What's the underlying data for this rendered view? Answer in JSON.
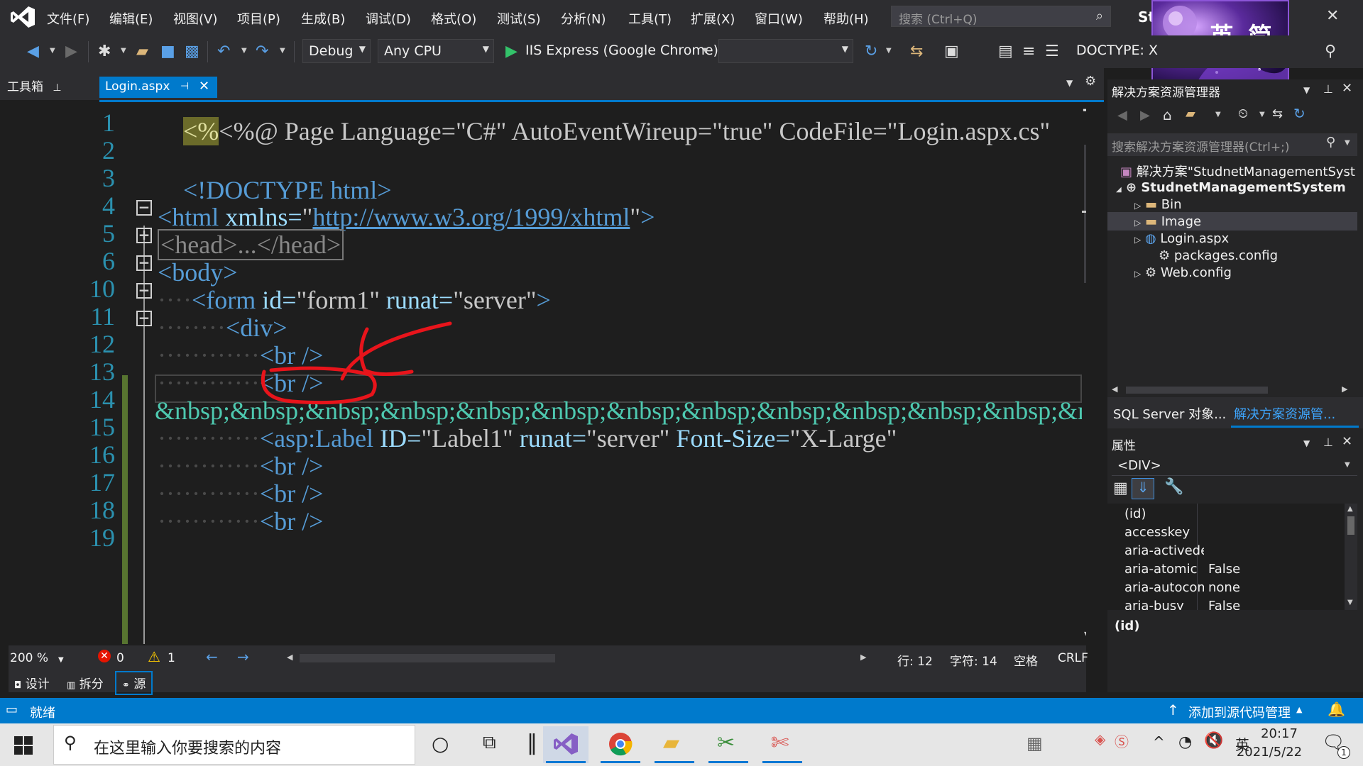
{
  "menu": [
    "文件(F)",
    "编辑(E)",
    "视图(V)",
    "项目(P)",
    "生成(B)",
    "调试(D)",
    "格式(O)",
    "测试(S)",
    "分析(N)",
    "工具(T)",
    "扩展(X)",
    "窗口(W)",
    "帮助(H)"
  ],
  "quick_search": {
    "placeholder": "搜索 (Ctrl+Q)"
  },
  "title_short": "St",
  "avatar_text": "英 简",
  "toolbar": {
    "config": "Debug",
    "platform": "Any CPU",
    "run_target": "IIS Express (Google Chrome)",
    "doctype": "DOCTYPE: X"
  },
  "tabs": {
    "toolbox": "工具箱",
    "file": "Login.aspx"
  },
  "editor": {
    "line_numbers": [
      "1",
      "2",
      "3",
      "4",
      "5",
      "6",
      "10",
      "11",
      "12",
      "13",
      "14",
      "15",
      "16",
      "17",
      "18",
      "19"
    ],
    "lines": {
      "l1": {
        "pre": "<%@ Page Language=\"C#\" AutoEventWireup=\"true\" CodeFile=\"Login.aspx.cs\""
      },
      "l3": {
        "tag": "<!DOCTYPE html>"
      },
      "l5": {
        "open": "<html",
        "attr": " xmlns=",
        "q1": "\"",
        "url": "http://www.w3.org/1999/xhtml",
        "q2": "\"",
        "close": ">"
      },
      "l6": {
        "collapsed": "<head>...</head>"
      },
      "l10": {
        "tag": "<body>"
      },
      "l11": {
        "dots": "····",
        "open": "<form",
        "a1": " id=",
        "v1": "\"form1\"",
        "a2": " runat=",
        "v2": "\"server\"",
        "close": ">"
      },
      "l12": {
        "dots": "········",
        "tag": "<div>"
      },
      "l13": {
        "dots": "············",
        "tag": "<br />"
      },
      "l14": {
        "dots": "············",
        "tag": "<br />"
      },
      "l15": {
        "text": "&nbsp;&nbsp;&nbsp;&nbsp;&nbsp;&nbsp;&nbsp;&nbsp;&nbsp;&nbsp;&nbsp;&nbsp;&nbsp;"
      },
      "l16": {
        "dots": "············",
        "open": "<asp:Label",
        "a1": " ID=",
        "v1": "\"Label1\"",
        "a2": " runat=",
        "v2": "\"server\"",
        "a3": " Font-Size=",
        "v3": "\"X-Large\""
      },
      "l17": {
        "dots": "············",
        "tag": "<br />"
      },
      "l18": {
        "dots": "············",
        "tag": "<br />"
      },
      "l19": {
        "dots": "············",
        "tag": "<br />"
      }
    }
  },
  "editor_status": {
    "zoom": "200 %",
    "errors": "0",
    "warnings": "1",
    "line": "行: 12",
    "char": "字符: 14",
    "spaces": "空格",
    "eol": "CRLF"
  },
  "view_tabs": [
    "设计",
    "拆分",
    "源"
  ],
  "solution_explorer": {
    "title": "解决方案资源管理器",
    "search_placeholder": "搜索解决方案资源管理器(Ctrl+;)",
    "solution": "解决方案\"StudnetManagementSyst",
    "project": "StudnetManagementSystem",
    "items": [
      "Bin",
      "Image",
      "Login.aspx",
      "packages.config",
      "Web.config"
    ]
  },
  "panel_tabs": [
    "SQL Server 对象...",
    "解决方案资源管..."
  ],
  "properties": {
    "title": "属性",
    "object": "<DIV>",
    "rows": [
      {
        "name": "(id)",
        "value": ""
      },
      {
        "name": "accesskey",
        "value": ""
      },
      {
        "name": "aria-activede",
        "value": ""
      },
      {
        "name": "aria-atomic",
        "value": "False"
      },
      {
        "name": "aria-autocom",
        "value": "none"
      },
      {
        "name": "aria-busy",
        "value": "False"
      }
    ],
    "description": "(id)"
  },
  "statusbar": {
    "state": "就绪",
    "source_control": "添加到源代码管理"
  },
  "taskbar": {
    "search_placeholder": "在这里输入你要搜索的内容",
    "time": "20:17",
    "date": "2021/5/22",
    "notif_count": "1"
  },
  "colors": {
    "accent": "#007acc",
    "tag": "#569cd6",
    "attr": "#9cdcfe",
    "lineno": "#2b91af",
    "annotation": "#e8141b"
  }
}
